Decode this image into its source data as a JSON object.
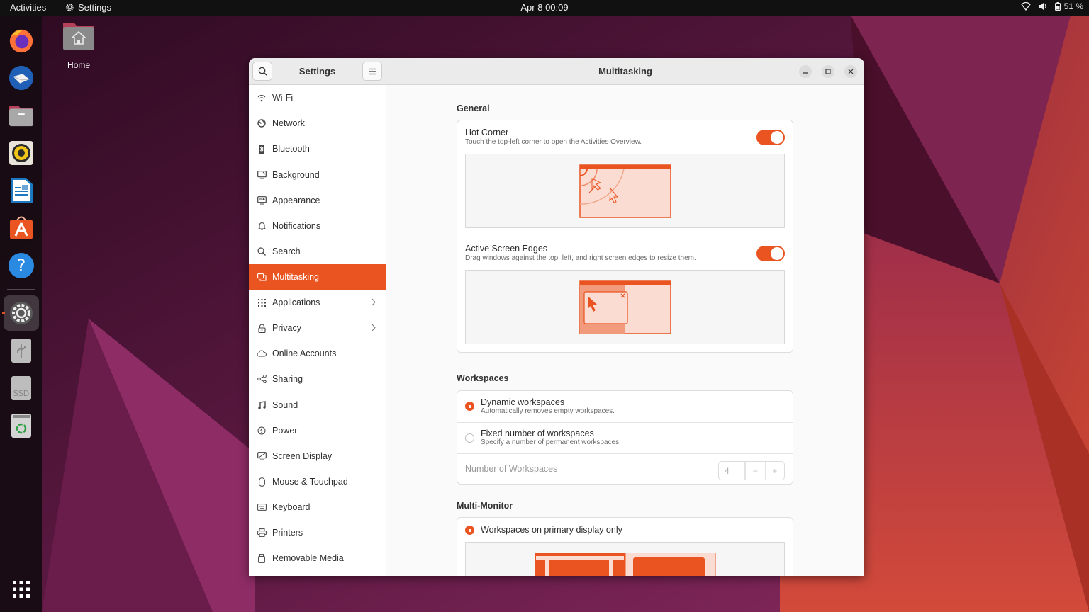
{
  "topbar": {
    "activities": "Activities",
    "app_name": "Settings",
    "clock": "Apr 8  00:09",
    "battery": "51 %"
  },
  "desktop": {
    "home_label": "Home"
  },
  "dock": {
    "items": [
      {
        "name": "firefox",
        "icon": "firefox-icon"
      },
      {
        "name": "thunderbird",
        "icon": "thunderbird-icon"
      },
      {
        "name": "files",
        "icon": "files-icon"
      },
      {
        "name": "rhythmbox",
        "icon": "rhythmbox-icon"
      },
      {
        "name": "libreoffice-writer",
        "icon": "writer-icon"
      },
      {
        "name": "ubuntu-software",
        "icon": "software-icon"
      },
      {
        "name": "help",
        "icon": "help-icon"
      },
      {
        "name": "settings",
        "icon": "settings-icon",
        "running": true
      },
      {
        "name": "usb-drive",
        "icon": "usb-icon"
      },
      {
        "name": "ssd-drive",
        "icon": "ssd-icon",
        "label": "SSD"
      },
      {
        "name": "trash",
        "icon": "trash-icon"
      }
    ],
    "show_apps": "show-apps-icon"
  },
  "window": {
    "sidebar_title": "Settings",
    "title": "Multitasking",
    "accent": "#e95420"
  },
  "sidebar": {
    "items": [
      {
        "label": "Wi-Fi",
        "icon": "wifi-icon"
      },
      {
        "label": "Network",
        "icon": "network-icon"
      },
      {
        "label": "Bluetooth",
        "icon": "bluetooth-icon"
      },
      {
        "label": "Background",
        "icon": "background-icon"
      },
      {
        "label": "Appearance",
        "icon": "appearance-icon"
      },
      {
        "label": "Notifications",
        "icon": "bell-icon"
      },
      {
        "label": "Search",
        "icon": "search-icon"
      },
      {
        "label": "Multitasking",
        "icon": "multitasking-icon",
        "selected": true
      },
      {
        "label": "Applications",
        "icon": "apps-grid-icon",
        "chevron": true
      },
      {
        "label": "Privacy",
        "icon": "lock-icon",
        "chevron": true
      },
      {
        "label": "Online Accounts",
        "icon": "cloud-icon"
      },
      {
        "label": "Sharing",
        "icon": "share-icon"
      },
      {
        "label": "Sound",
        "icon": "music-note-icon"
      },
      {
        "label": "Power",
        "icon": "power-icon"
      },
      {
        "label": "Screen Display",
        "icon": "display-icon"
      },
      {
        "label": "Mouse & Touchpad",
        "icon": "mouse-icon"
      },
      {
        "label": "Keyboard",
        "icon": "keyboard-icon"
      },
      {
        "label": "Printers",
        "icon": "printer-icon"
      },
      {
        "label": "Removable Media",
        "icon": "removable-media-icon"
      }
    ]
  },
  "general": {
    "heading": "General",
    "hot_corner": {
      "title": "Hot Corner",
      "subtitle": "Touch the top-left corner to open the Activities Overview.",
      "enabled": true
    },
    "active_edges": {
      "title": "Active Screen Edges",
      "subtitle": "Drag windows against the top, left, and right screen edges to resize them.",
      "enabled": true
    }
  },
  "workspaces": {
    "heading": "Workspaces",
    "dynamic": {
      "title": "Dynamic workspaces",
      "subtitle": "Automatically removes empty workspaces.",
      "selected": true
    },
    "fixed": {
      "title": "Fixed number of workspaces",
      "subtitle": "Specify a number of permanent workspaces.",
      "selected": false
    },
    "number_label": "Number of Workspaces",
    "number_value": "4",
    "minus": "−",
    "plus": "+"
  },
  "multi_monitor": {
    "heading": "Multi-Monitor",
    "primary_only": {
      "title": "Workspaces on primary display only",
      "selected": true
    }
  }
}
